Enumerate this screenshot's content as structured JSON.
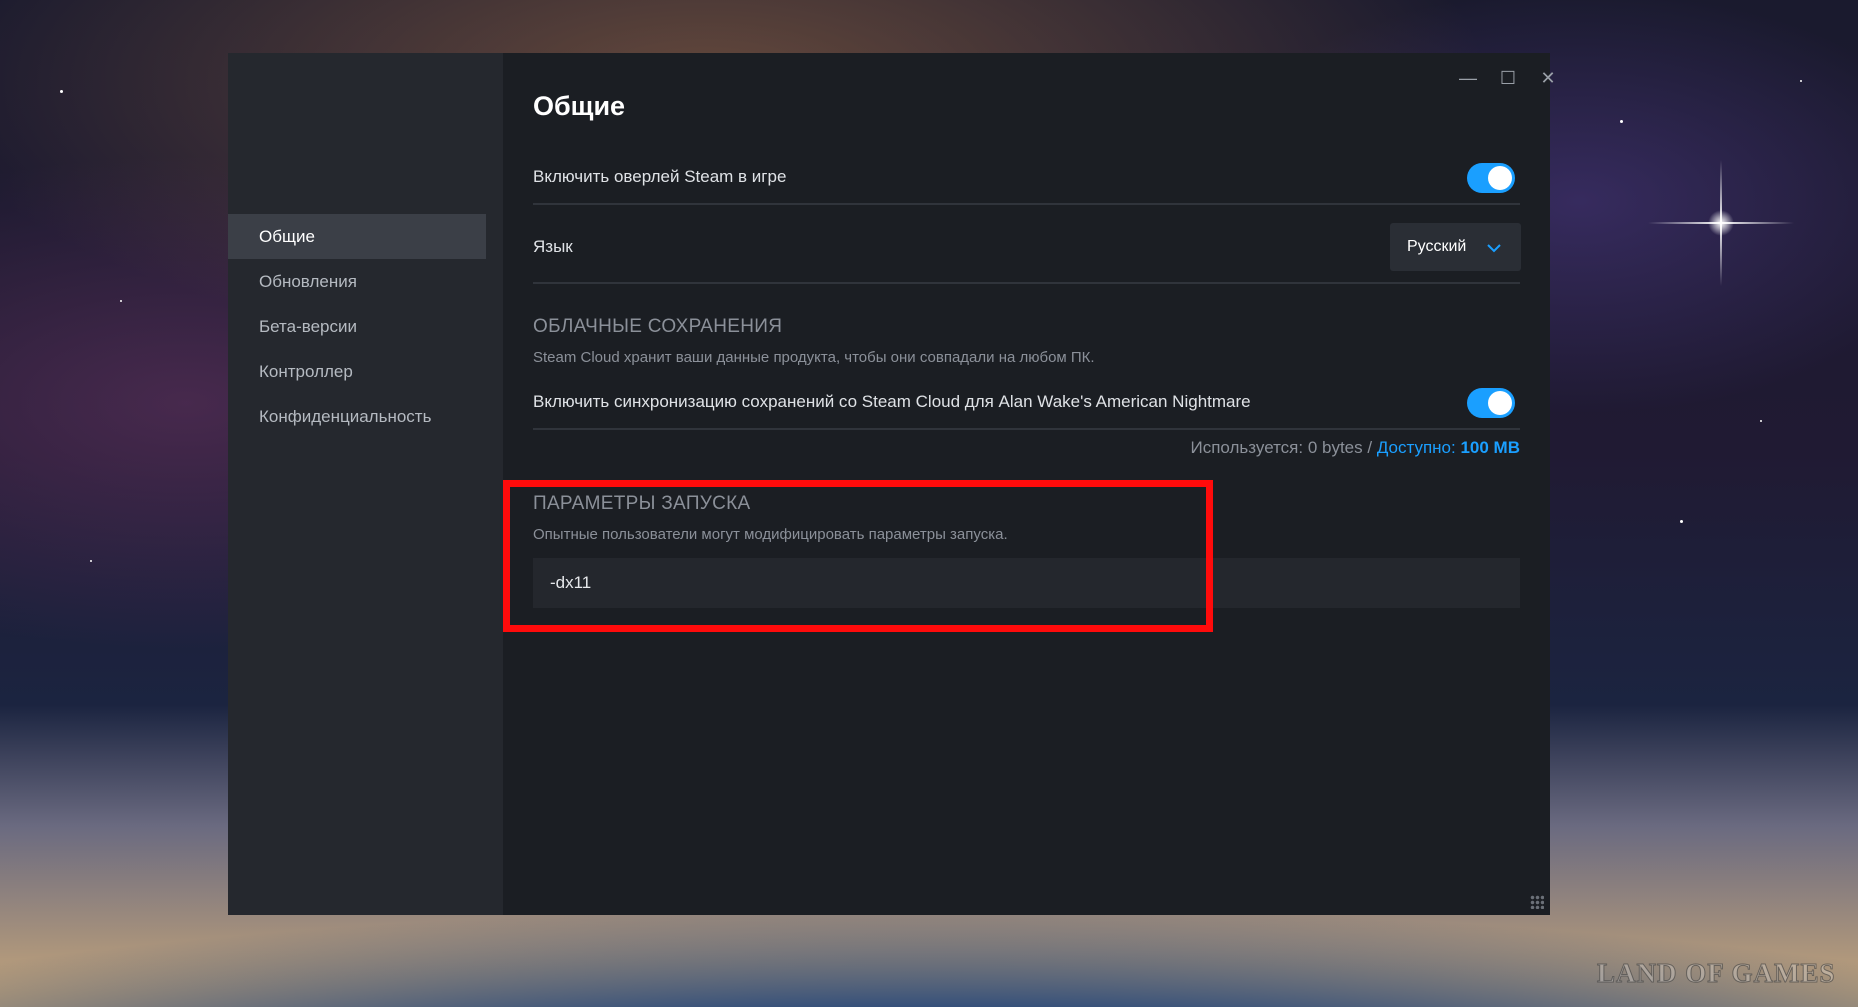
{
  "sidebar": {
    "items": [
      {
        "label": "Общие",
        "active": true
      },
      {
        "label": "Обновления",
        "active": false
      },
      {
        "label": "Бета-версии",
        "active": false
      },
      {
        "label": "Контроллер",
        "active": false
      },
      {
        "label": "Конфиденциальность",
        "active": false
      }
    ]
  },
  "window_controls": {
    "minimize": "—",
    "maximize": "☐",
    "close": "✕"
  },
  "page": {
    "title": "Общие"
  },
  "overlay": {
    "label": "Включить оверлей Steam в игре",
    "enabled": true
  },
  "language": {
    "label": "Язык",
    "selected": "Русский"
  },
  "cloud": {
    "title": "ОБЛАЧНЫЕ СОХРАНЕНИЯ",
    "description": "Steam Cloud хранит ваши данные продукта, чтобы они совпадали на любом ПК.",
    "sync_label": "Включить синхронизацию сохранений со Steam Cloud для Alan Wake's American Nightmare",
    "sync_enabled": true,
    "usage_text": "Используется: 0 bytes / ",
    "available_label": "Доступно:",
    "available_value": "100 MB"
  },
  "launch": {
    "title": "ПАРАМЕТРЫ ЗАПУСКА",
    "description": "Опытные пользователи могут модифицировать параметры запуска.",
    "value": "-dx11"
  },
  "colors": {
    "accent": "#1a9fff",
    "highlight": "#ff0b0b"
  },
  "watermark": "LAND OF GAMES"
}
